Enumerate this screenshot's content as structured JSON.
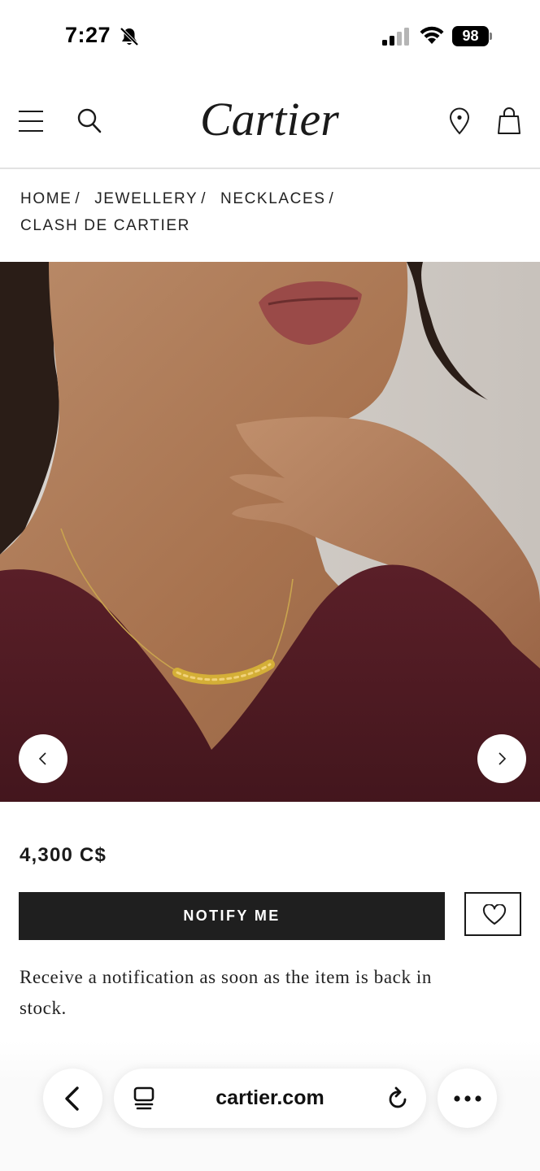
{
  "status_bar": {
    "time": "7:27",
    "battery": "98"
  },
  "header": {
    "logo": "Cartier"
  },
  "breadcrumb": [
    {
      "label": "HOME"
    },
    {
      "label": "JEWELLERY"
    },
    {
      "label": "NECKLACES"
    },
    {
      "label": "CLASH DE CARTIER"
    }
  ],
  "breadcrumb_separator": "/",
  "product": {
    "price": "4,300 C$",
    "notify_label": "NOTIFY ME",
    "stock_note": "Receive a notification as soon as the item is back in stock."
  },
  "browser": {
    "url": "cartier.com"
  },
  "icons": {
    "bell": "bell-slash-icon",
    "signal": "cellular-signal-icon",
    "wifi": "wifi-icon",
    "menu": "hamburger-icon",
    "search": "search-icon",
    "location": "location-pin-icon",
    "bag": "shopping-bag-icon",
    "prev": "chevron-left-icon",
    "next": "chevron-right-icon",
    "wishlist": "heart-icon",
    "back": "back-chevron-icon",
    "tabs": "tabs-icon",
    "reload": "reload-icon",
    "more": "more-dots-icon"
  },
  "colors": {
    "button_bg": "#1f1f1f",
    "dress": "#4e1a22",
    "skin": "#b07e5d"
  }
}
